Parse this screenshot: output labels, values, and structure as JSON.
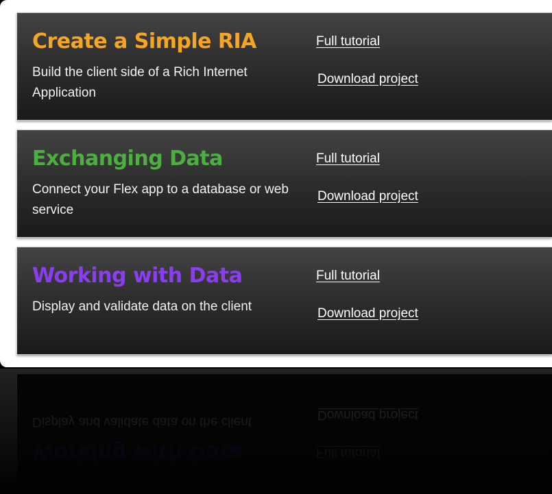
{
  "tutorials": [
    {
      "title": "Create a Simple RIA",
      "title_color": "#f5a623",
      "description": "Build the client side of a Rich Internet Application",
      "full_tutorial_label": "Full tutorial",
      "download_label": "Download project"
    },
    {
      "title": "Exchanging Data",
      "title_color": "#4caf3f",
      "description": "Connect your Flex app to a database or web service",
      "full_tutorial_label": "Full tutorial",
      "download_label": "Download project"
    },
    {
      "title": "Working with Data",
      "title_color": "#8a3ef0",
      "description": "Display and validate data on the client",
      "full_tutorial_label": "Full tutorial",
      "download_label": "Download project"
    }
  ],
  "colors": {
    "panel_background": "#2f2f2f",
    "page_background": "#000000",
    "frame_background": "#ffffff",
    "link_color": "#ffffff"
  }
}
